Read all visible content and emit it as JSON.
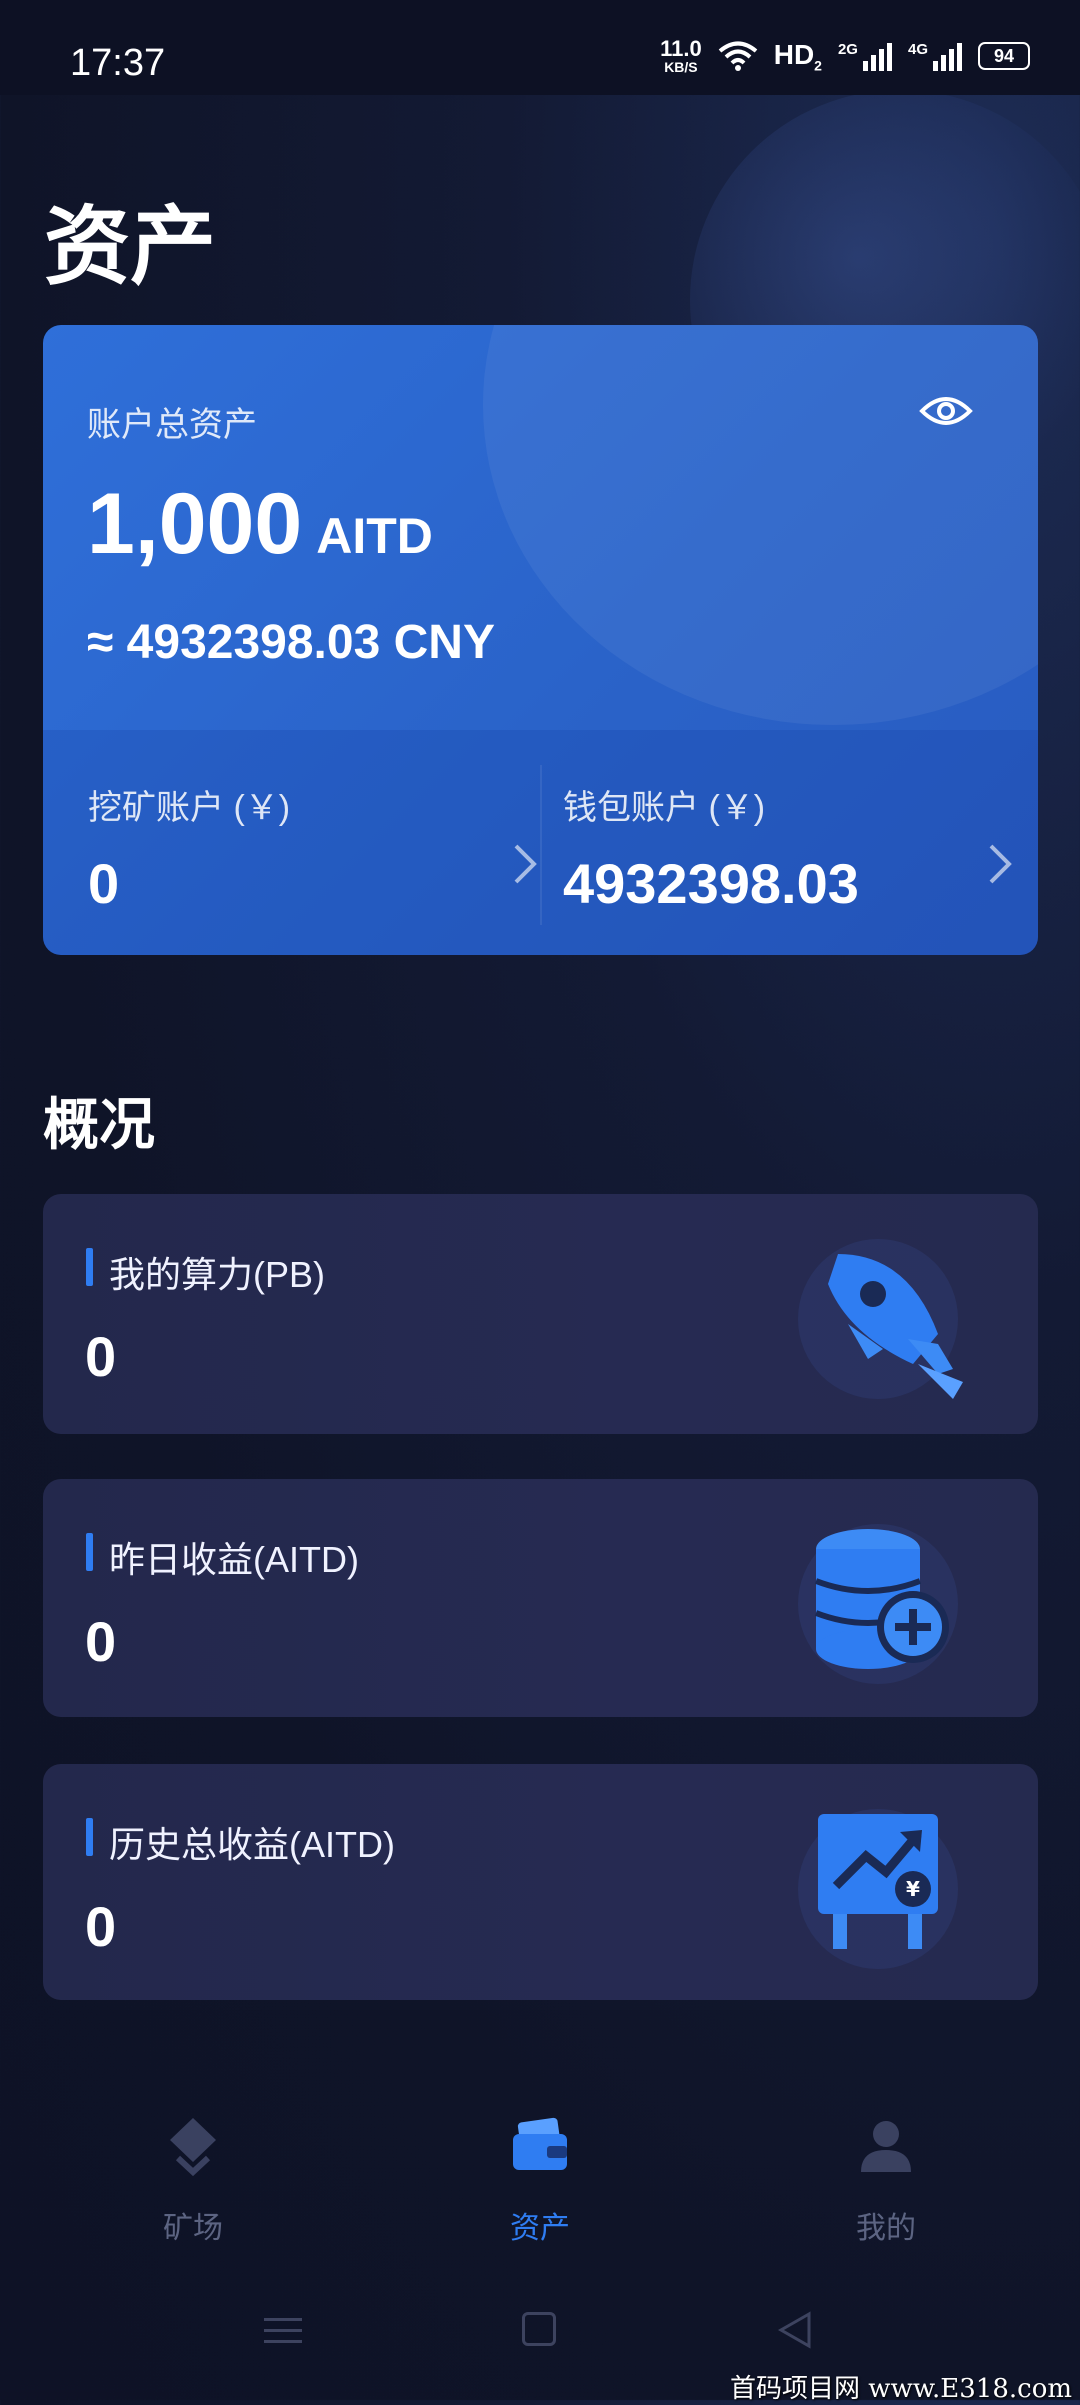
{
  "status_bar": {
    "time": "17:37",
    "net_speed_value": "11.0",
    "net_speed_unit": "KB/S",
    "hd_label": "HD",
    "hd_sub": "2",
    "sig1_label": "2G",
    "sig2_label": "4G",
    "battery": "94"
  },
  "page": {
    "title": "资产"
  },
  "asset_card": {
    "label": "账户总资产",
    "total_value": "1,000",
    "total_unit": "AITD",
    "cny_value": "≈ 4932398.03 CNY",
    "mining_label": "挖矿账户 (￥)",
    "mining_value": "0",
    "wallet_label": "钱包账户 (￥)",
    "wallet_value": "4932398.03"
  },
  "overview": {
    "title": "概况",
    "cards": [
      {
        "label": "我的算力(PB)",
        "value": "0",
        "icon": "rocket-icon"
      },
      {
        "label": "昨日收益(AITD)",
        "value": "0",
        "icon": "coin-stack-icon"
      },
      {
        "label": "历史总收益(AITD)",
        "value": "0",
        "icon": "growth-chart-icon"
      }
    ]
  },
  "bottom_nav": {
    "items": [
      {
        "label": "矿场",
        "icon": "mining-field-icon",
        "active": false
      },
      {
        "label": "资产",
        "icon": "wallet-icon",
        "active": true
      },
      {
        "label": "我的",
        "icon": "profile-icon",
        "active": false
      }
    ]
  },
  "watermark": "首码项目网 www.E318.com",
  "colors": {
    "accent": "#2f7df2",
    "card_blue": "#2f6fd9",
    "background": "#0f1428"
  }
}
